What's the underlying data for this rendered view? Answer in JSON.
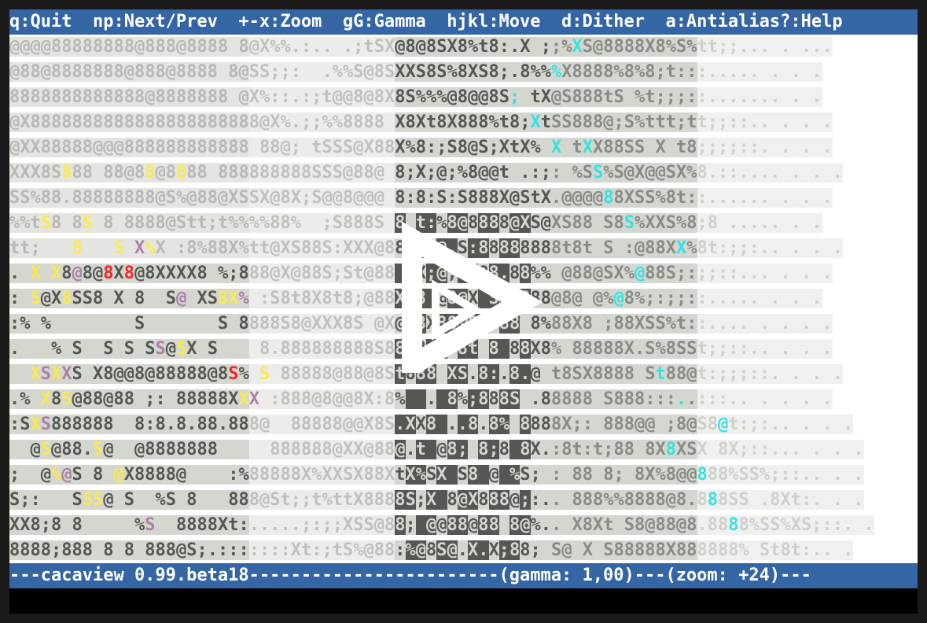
{
  "app": {
    "name": "cacaview"
  },
  "top_bar": {
    "text": "q:Quit  np:Next/Prev  +-x:Zoom  gG:Gamma  hjkl:Move  d:Dither  a:Antialias?:Help"
  },
  "status_bar": {
    "text": "---cacaview 0.99.beta18------------------------(gamma: 1,00)---(zoom: +24)---"
  },
  "overlay": {
    "icon": "play-icon",
    "color": "#ffffff"
  },
  "palette": {
    "white": "#ffffff",
    "light": "#d3d7cf",
    "mid": "#555753",
    "dark": "#2e3436",
    "yellow": "#fce94f",
    "cyan": "#34e2e2",
    "teal": "#06989a",
    "red": "#ef2929",
    "purple": "#ad7fa8",
    "bar": "#3465a4"
  },
  "canvas": {
    "rows": [
      "@@@@88888888@888@8888 8@X%%.:.. .;tSX@8@8SX8%t8:.X ;;%XS@8888X8%S%tt;;... . ...",
      "@88@8888888@888@8888 8@SS;;:  .%%S@8SXXS8S%8XS8;.8%%%X8888%8%8;t:::..... . . .",
      "8888888888888@8888888 @X%::.:;t@@8@8X8S%%%@8@@8S; tX@S888tS %t;;;::....... . .",
      "@X8888888888888888888888@X%.;;%%8888 X8Xt8X888%t8;XtSS888@;S%ttt;tt;;::.. . . .",
      "@XX88888@@@888888888888 88@; tSSS@X88X%8:;S8@S;XtX% X tXX88SS X t8;;;;::. . . .",
      "XXX8S888 88@88@8888 888888888SSS@88@ 8;X;@;%8@@t .:;: %SS%S@X@@SX%8.::.... . . .",
      "SS%88.88888888@S%@88@XSSX@8X;S@@8@@@ 8:8:S:S888X@StX.@@@@88XSS%8t::...... . . .",
      "%%tS8 8S 8 8888@Stt;t%%%%88%  ;S888S 8 t:%8@8888@XS@XS88 S8S%XXS%8;8 ..... . .",
      "tt;   8   S X%X :8%88X%tt@XS88S:XXX@88 t8@.S:88888888t8t S :@88XX%8t:;;:.. . . .",
      ". X X8@8@8X8@8XXXX8 %;888@X@88S;St@88 8X;@;8888.88%% @88@SX%@88S;:;;::... . . .",
      ": S@X8SS8 X 8  S@ XS8X% :S8t8X8t8;@88X 8 @8@X S@@888@8@ @%@8%;:;;::..... . . .",
      ":% %        S       S 8888S8@XXX8S @X@S8X88888888 8%88X8 ;88XSS%t::.... . . . .",
      ".   % S  S S SS@SX S    8.888888888S88@8;8 8t 8 88X8% 88888X.S%8SSt;;::.. . . .",
      "  XSXXS X8@@8@88888@8S% S 88888@88@8St888 XS.8:.8.@ t8SX8888 St88@t:;;;::. . . .",
      ".% X8S@88@88 ;: 88888XXX :888@8@@8X:8%  . 8%;888S .88888 S888:::..:::.. . . . .",
      ":SXS888888  8:8.8.88.888@  88888@@X8S.XX8 ..8.8% 8888X;: 888@@ ;8@S8@t:;:.. . . .",
      "  @S@88.S@  @8888888     888888@XX@88@.t @8; 8;8 8X.:8t:t;88 8X8XSX 8X;::... . . .",
      ";  @%@S 8 @X8888@    :%88888X%XXSX88XtX%SX S8 @ %S; : 88 8; 8X%8@@888%SS%;::.. . .",
      "S;:   SSS@ S  %S 8   888@St;;t%ttX8888S;X 8@X888@;:.. 888%%8888@8.888SS .8Xt:. . .",
      "XX8;8 8     %S  8888Xt:.....;:;;XSS@88; @@88@88 8@%.. X8Xt S8@88@8.8888%SS%XS;::. .",
      "8888;888 8 8 888@S;.:::::::Xt:;tS%@88:%@8S@.X.X;88; S@ X S88888X888888% St8t:.. ."
    ],
    "accents": [
      {
        "row": 5,
        "col": 5,
        "color": "yellow"
      },
      {
        "row": 5,
        "col": 8,
        "color": "yellow"
      },
      {
        "row": 5,
        "col": 13,
        "color": "yellow"
      },
      {
        "row": 5,
        "col": 16,
        "color": "yellow"
      },
      {
        "row": 5,
        "col": 19,
        "color": "yellow"
      },
      {
        "row": 7,
        "col": 3,
        "color": "yellow"
      },
      {
        "row": 7,
        "col": 7,
        "color": "yellow"
      },
      {
        "row": 8,
        "col": 6,
        "color": "yellow"
      },
      {
        "row": 8,
        "col": 10,
        "color": "yellow"
      },
      {
        "row": 8,
        "col": 11,
        "color": "yellow"
      },
      {
        "row": 8,
        "col": 12,
        "color": "purple"
      },
      {
        "row": 8,
        "col": 13,
        "color": "yellow"
      },
      {
        "row": 9,
        "col": 2,
        "color": "yellow"
      },
      {
        "row": 9,
        "col": 4,
        "color": "yellow"
      },
      {
        "row": 9,
        "col": 6,
        "color": "purple"
      },
      {
        "row": 9,
        "col": 9,
        "color": "red"
      },
      {
        "row": 9,
        "col": 11,
        "color": "red"
      },
      {
        "row": 9,
        "col": 19,
        "color": "yellow"
      },
      {
        "row": 10,
        "col": 2,
        "color": "yellow"
      },
      {
        "row": 10,
        "col": 5,
        "color": "yellow"
      },
      {
        "row": 10,
        "col": 16,
        "color": "purple"
      },
      {
        "row": 10,
        "col": 20,
        "color": "yellow"
      },
      {
        "row": 10,
        "col": 21,
        "color": "yellow"
      },
      {
        "row": 10,
        "col": 22,
        "color": "purple"
      },
      {
        "row": 12,
        "col": 5,
        "color": "yellow"
      },
      {
        "row": 12,
        "col": 7,
        "color": "yellow"
      },
      {
        "row": 12,
        "col": 10,
        "color": "yellow"
      },
      {
        "row": 12,
        "col": 12,
        "color": "yellow"
      },
      {
        "row": 12,
        "col": 14,
        "color": "purple"
      },
      {
        "row": 12,
        "col": 16,
        "color": "yellow"
      },
      {
        "row": 13,
        "col": 2,
        "color": "yellow"
      },
      {
        "row": 13,
        "col": 3,
        "color": "purple"
      },
      {
        "row": 13,
        "col": 4,
        "color": "yellow"
      },
      {
        "row": 13,
        "col": 5,
        "color": "purple"
      },
      {
        "row": 13,
        "col": 7,
        "color": "red"
      },
      {
        "row": 13,
        "col": 21,
        "color": "red"
      },
      {
        "row": 13,
        "col": 24,
        "color": "yellow"
      },
      {
        "row": 14,
        "col": 3,
        "color": "yellow"
      },
      {
        "row": 14,
        "col": 5,
        "color": "yellow"
      },
      {
        "row": 14,
        "col": 22,
        "color": "yellow"
      },
      {
        "row": 14,
        "col": 23,
        "color": "purple"
      },
      {
        "row": 15,
        "col": 2,
        "color": "yellow"
      },
      {
        "row": 15,
        "col": 3,
        "color": "purple"
      },
      {
        "row": 16,
        "col": 3,
        "color": "yellow"
      },
      {
        "row": 16,
        "col": 8,
        "color": "yellow"
      },
      {
        "row": 17,
        "col": 4,
        "color": "yellow"
      },
      {
        "row": 17,
        "col": 5,
        "color": "purple"
      },
      {
        "row": 17,
        "col": 10,
        "color": "yellow"
      },
      {
        "row": 18,
        "col": 7,
        "color": "yellow"
      },
      {
        "row": 18,
        "col": 8,
        "color": "yellow"
      },
      {
        "row": 18,
        "col": 13,
        "color": "yellow"
      },
      {
        "row": 19,
        "col": 13,
        "color": "purple"
      },
      {
        "row": 9,
        "col": 60,
        "color": "cyan"
      },
      {
        "row": 8,
        "col": 64,
        "color": "cyan"
      },
      {
        "row": 10,
        "col": 58,
        "color": "cyan"
      },
      {
        "row": 2,
        "col": 48,
        "color": "cyan"
      },
      {
        "row": 3,
        "col": 50,
        "color": "cyan"
      },
      {
        "row": 4,
        "col": 52,
        "color": "cyan"
      },
      {
        "row": 4,
        "col": 55,
        "color": "cyan"
      },
      {
        "row": 5,
        "col": 56,
        "color": "cyan"
      },
      {
        "row": 6,
        "col": 57,
        "color": "cyan"
      },
      {
        "row": 7,
        "col": 59,
        "color": "cyan"
      },
      {
        "row": 13,
        "col": 62,
        "color": "cyan"
      },
      {
        "row": 14,
        "col": 64,
        "color": "cyan"
      },
      {
        "row": 15,
        "col": 68,
        "color": "cyan"
      },
      {
        "row": 16,
        "col": 63,
        "color": "cyan"
      },
      {
        "row": 17,
        "col": 66,
        "color": "cyan"
      },
      {
        "row": 18,
        "col": 67,
        "color": "cyan"
      },
      {
        "row": 19,
        "col": 69,
        "color": "cyan"
      },
      {
        "row": 20,
        "col": 71,
        "color": "cyan"
      },
      {
        "row": 1,
        "col": 52,
        "color": "cyan"
      },
      {
        "row": 0,
        "col": 54,
        "color": "cyan"
      }
    ],
    "light_cols": [
      0,
      23
    ],
    "dark_zone": {
      "from_col": 37,
      "to_col": 50,
      "from_row": 7,
      "to_row": 21
    },
    "white_cols": [
      66,
      80
    ]
  }
}
